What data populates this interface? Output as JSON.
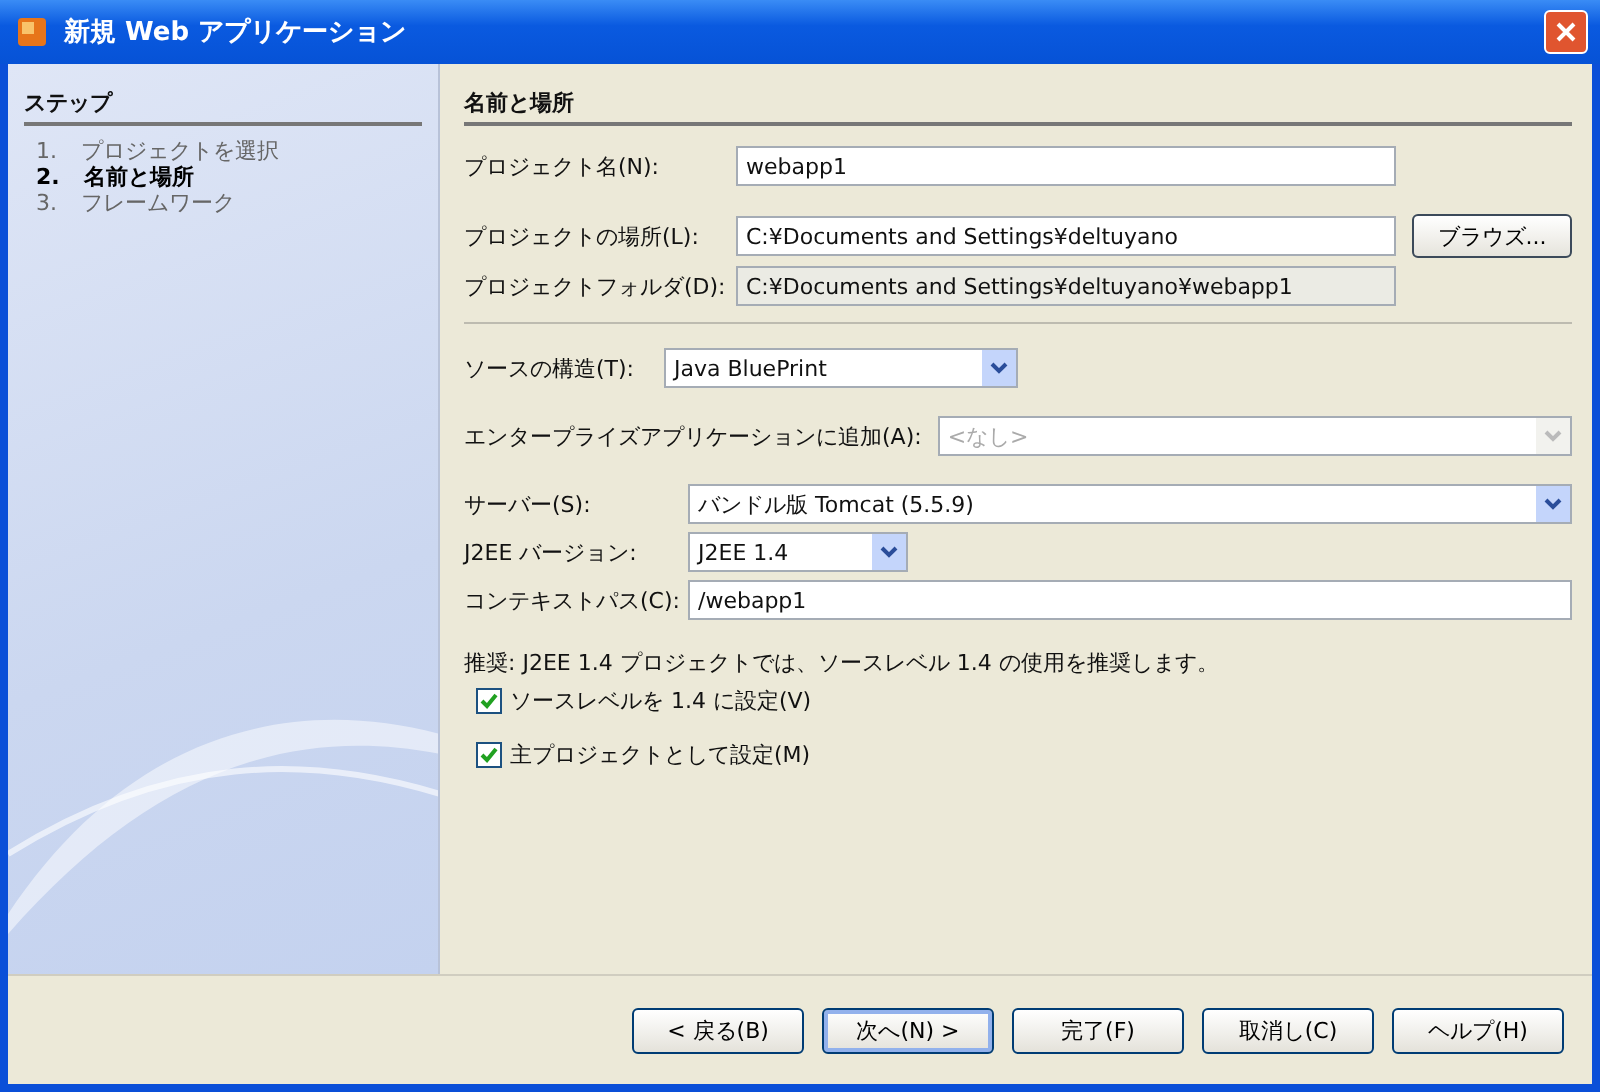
{
  "window": {
    "title": "新規 Web アプリケーション"
  },
  "steps": {
    "heading": "ステップ",
    "items": [
      {
        "number": "1.",
        "label": "プロジェクトを選択",
        "selected": false
      },
      {
        "number": "2.",
        "label": "名前と場所",
        "selected": true
      },
      {
        "number": "3.",
        "label": "フレームワーク",
        "selected": false
      }
    ]
  },
  "section_heading": "名前と場所",
  "location_fields": [
    {
      "kind": "text",
      "label": "プロジェクト名(N):",
      "value": "webapp1"
    },
    {
      "kind": "text",
      "label": "プロジェクトの場所(L):",
      "value": "C:¥Documents and Settings¥deltuyano",
      "button": "ブラウズ..."
    },
    {
      "kind": "readonly",
      "label": "プロジェクトフォルダ(D):",
      "value": "C:¥Documents and Settings¥deltuyano¥webapp1"
    }
  ],
  "settings_fields": [
    {
      "kind": "select",
      "label": "ソースの構造(T):",
      "value": "Java BluePrint",
      "disabled": false
    },
    {
      "kind": "select",
      "label": "エンタープライズアプリケーションに追加(A):",
      "value": "<なし>",
      "disabled": true
    },
    {
      "kind": "select",
      "label": "サーバー(S):",
      "value": "バンドル版 Tomcat (5.5.9)",
      "disabled": false
    },
    {
      "kind": "select",
      "label": "J2EE バージョン:",
      "value": "J2EE 1.4",
      "disabled": false
    },
    {
      "kind": "text",
      "label": "コンテキストパス(C):",
      "value": "/webapp1"
    }
  ],
  "note": "推奨: J2EE 1.4 プロジェクトでは、ソースレベル 1.4 の使用を推奨します。",
  "checkboxes": [
    {
      "label": "ソースレベルを 1.4 に設定(V)",
      "checked": true
    },
    {
      "label": "主プロジェクトとして設定(M)",
      "checked": true
    }
  ],
  "buttons": [
    {
      "label": "< 戻る(B)",
      "default": false
    },
    {
      "label": "次へ(N) >",
      "default": true
    },
    {
      "label": "完了(F)",
      "default": false
    },
    {
      "label": "取消し(C)",
      "default": false
    },
    {
      "label": "ヘルプ(H)",
      "default": false
    }
  ]
}
